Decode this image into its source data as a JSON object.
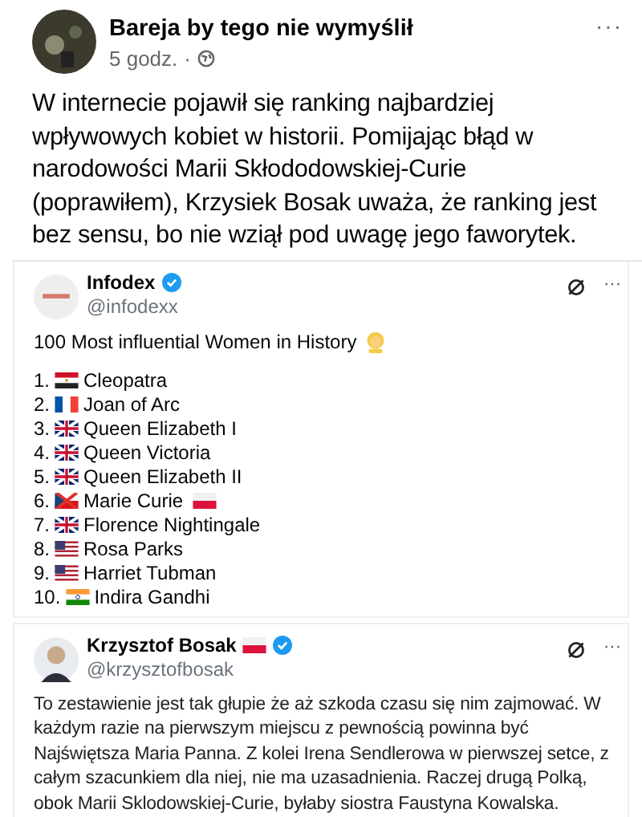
{
  "post": {
    "author": "Bareja by tego nie wymyślił",
    "time": "5 godz.",
    "audience_sep": "·",
    "more": "···",
    "text": "W internecie pojawił się ranking najbardziej wpływowych kobiet w historii. Pomijając błąd w narodowości Marii Skłododowskiej-Curie (poprawiłem), Krzysiek Bosak uważa, że ranking jest bez sensu, bo nie wziął pod uwagę jego faworytek."
  },
  "tweets": [
    {
      "name": "Infodex",
      "handle": "@infodexx",
      "verified": true,
      "name_flag": false,
      "kind": "ranking",
      "more": "···",
      "title": "100 Most influential Women in History",
      "items": [
        {
          "number": "1.",
          "kind": "egypt",
          "name": "Cleopatra",
          "polish_flag_after": false
        },
        {
          "number": "2.",
          "kind": "france",
          "name": "Joan of Arc",
          "polish_flag_after": false
        },
        {
          "number": "3.",
          "kind": "uk",
          "name": "Queen Elizabeth I",
          "polish_flag_after": false
        },
        {
          "number": "4.",
          "kind": "uk",
          "name": "Queen Victoria",
          "polish_flag_after": false
        },
        {
          "number": "5.",
          "kind": "uk",
          "name": "Queen Elizabeth II",
          "polish_flag_after": false
        },
        {
          "number": "6.",
          "kind": "crossed",
          "name": "Marie Curie",
          "polish_flag_after": true
        },
        {
          "number": "7.",
          "kind": "uk",
          "name": "Florence Nightingale",
          "polish_flag_after": false
        },
        {
          "number": "8.",
          "kind": "usa",
          "name": "Rosa Parks",
          "polish_flag_after": false
        },
        {
          "number": "9.",
          "kind": "usa",
          "name": "Harriet Tubman",
          "polish_flag_after": false
        },
        {
          "number": "10.",
          "kind": "india",
          "name": "Indira Gandhi",
          "polish_flag_after": false
        }
      ]
    },
    {
      "name": "Krzysztof Bosak",
      "handle": "@krzysztofbosak",
      "verified": true,
      "name_flag": true,
      "kind": "reply",
      "more": "···",
      "text": "To zestawienie jest tak głupie że aż szkoda czasu się nim zajmować. W każdym razie na pierwszym miejscu z pewnością powinna być Najświętsza Maria Panna. Z kolei Irena Sendlerowa w pierwszej setce, z całym szacunkiem dla niej, nie ma uzasadnienia. Raczej drugą Polką, obok Marii Sklodowskiej-Curie, byłaby siostra Faustyna Kowalska."
    }
  ]
}
